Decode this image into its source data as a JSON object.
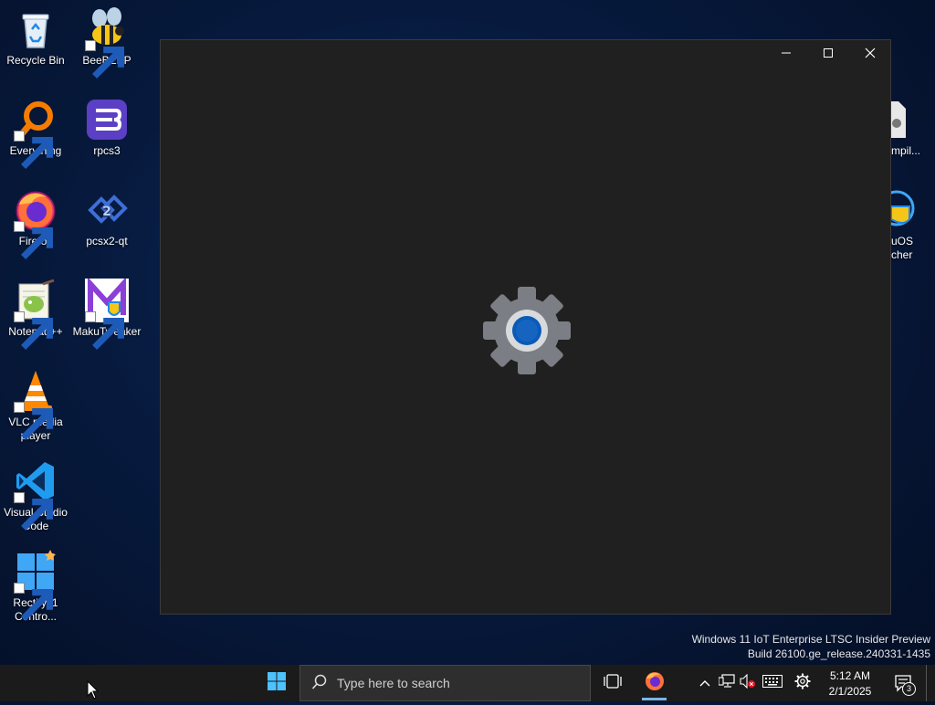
{
  "desktop": {
    "icons": [
      {
        "label": "Recycle Bin",
        "icon": "recycle-bin-icon"
      },
      {
        "label": "BeeBEEP",
        "icon": "bee-icon"
      },
      {
        "label": "Everything",
        "icon": "magnifier-icon"
      },
      {
        "label": "rpcs3",
        "icon": "rpcs3-icon"
      },
      {
        "label": "Firefox",
        "icon": "firefox-icon"
      },
      {
        "label": "pcsx2-qt",
        "icon": "pcsx2-icon"
      },
      {
        "label": "Notepad++",
        "icon": "notepad-plus-plus-icon"
      },
      {
        "label": "MakuTweaker",
        "icon": "makutweaker-icon"
      },
      {
        "label": "VLC media player",
        "icon": "vlc-cone-icon"
      },
      {
        "label": "Visual Studio Code",
        "icon": "vscode-icon"
      },
      {
        "label": "Rectify11 Contro...",
        "icon": "windows-logo-icon"
      }
    ],
    "right_edge_icons": [
      {
        "label": "mpil...",
        "icon": "settings-file-icon"
      },
      {
        "label": "uOS\ncher",
        "icon": "globe-shield-icon"
      }
    ]
  },
  "window": {
    "splash_icon": "settings-gear-icon",
    "controls": [
      "minimize-icon",
      "maximize-icon",
      "close-icon"
    ]
  },
  "watermark": {
    "line1": "Windows 11 IoT Enterprise LTSC Insider Preview",
    "line2": "Build 26100.ge_release.240331-1435"
  },
  "taskbar": {
    "search_placeholder": "Type here to search",
    "time": "5:12 AM",
    "date": "2/1/2025",
    "notification_count": "3"
  },
  "colors": {
    "accent": "#0067c0",
    "window_bg": "#202020",
    "taskbar_bg": "#1b1b1b"
  }
}
